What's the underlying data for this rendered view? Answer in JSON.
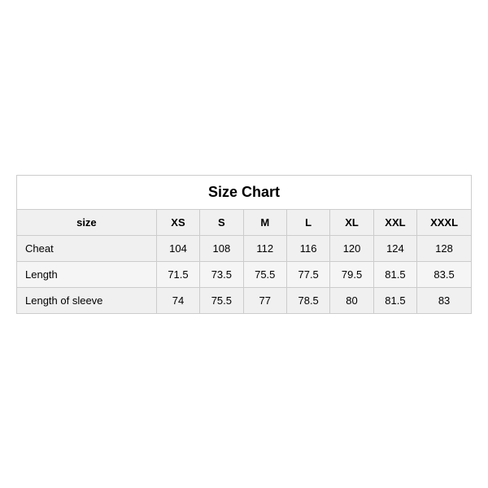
{
  "table": {
    "title": "Size Chart",
    "headers": [
      "size",
      "XS",
      "S",
      "M",
      "L",
      "XL",
      "XXL",
      "XXXL"
    ],
    "rows": [
      {
        "label": "Cheat",
        "values": [
          "104",
          "108",
          "112",
          "116",
          "120",
          "124",
          "128"
        ],
        "shaded": true
      },
      {
        "label": "Length",
        "values": [
          "71.5",
          "73.5",
          "75.5",
          "77.5",
          "79.5",
          "81.5",
          "83.5"
        ],
        "shaded": false
      },
      {
        "label": "Length of sleeve",
        "values": [
          "74",
          "75.5",
          "77",
          "78.5",
          "80",
          "81.5",
          "83"
        ],
        "shaded": true
      }
    ]
  }
}
